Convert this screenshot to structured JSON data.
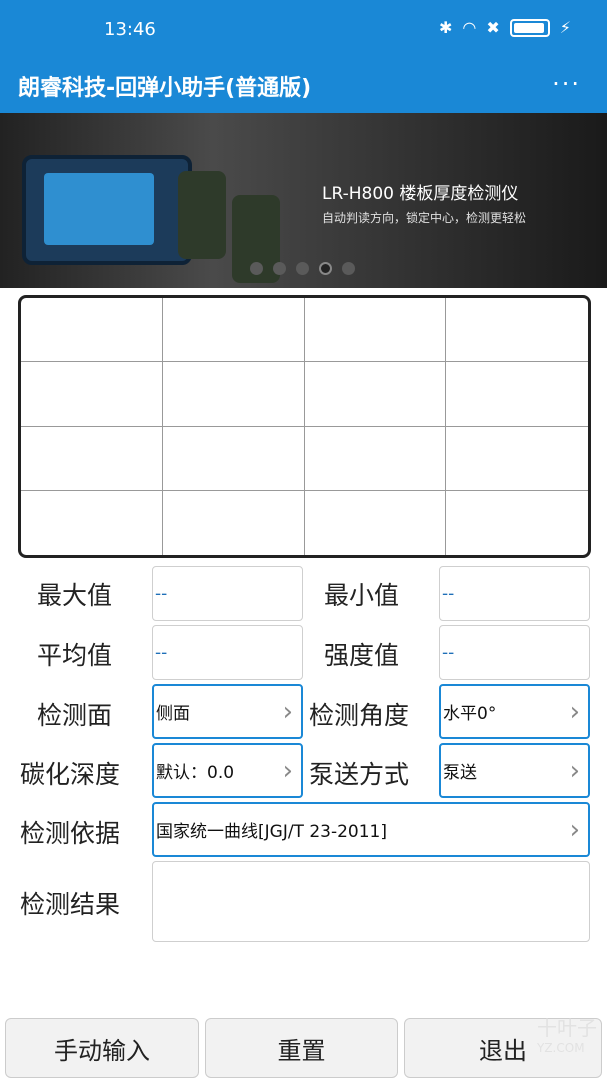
{
  "status": {
    "time": "13:46",
    "bt": "✱",
    "wifi": "◠",
    "x": "✖",
    "bolt": "⚡"
  },
  "app": {
    "title": "朗睿科技-回弹小助手(普通版)",
    "more": "···"
  },
  "banner": {
    "title": "LR-H800  楼板厚度检测仪",
    "subtitle": "自动判读方向，锁定中心，检测更轻松"
  },
  "fields": {
    "max_label": "最大值",
    "max_value": "--",
    "min_label": "最小值",
    "min_value": "--",
    "avg_label": "平均值",
    "avg_value": "--",
    "strength_label": "强度值",
    "strength_value": "--",
    "surface_label": "检测面",
    "surface_value": "侧面",
    "angle_label": "检测角度",
    "angle_value": "水平0°",
    "carb_label": "碳化深度",
    "carb_value": "默认：0.0",
    "pump_label": "泵送方式",
    "pump_value": "泵送",
    "basis_label": "检测依据",
    "basis_value": "国家统一曲线[JGJ/T 23-2011]",
    "result_label": "检测结果"
  },
  "buttons": {
    "manual": "手动输入",
    "reset": "重置",
    "exit": "退出"
  },
  "watermark": {
    "text": "十叶子",
    "sub": "YZ.COM"
  },
  "icons": {
    "chevron": "›"
  },
  "colors": {
    "primary": "#1a88d6",
    "value_text": "#1e6fb8"
  }
}
